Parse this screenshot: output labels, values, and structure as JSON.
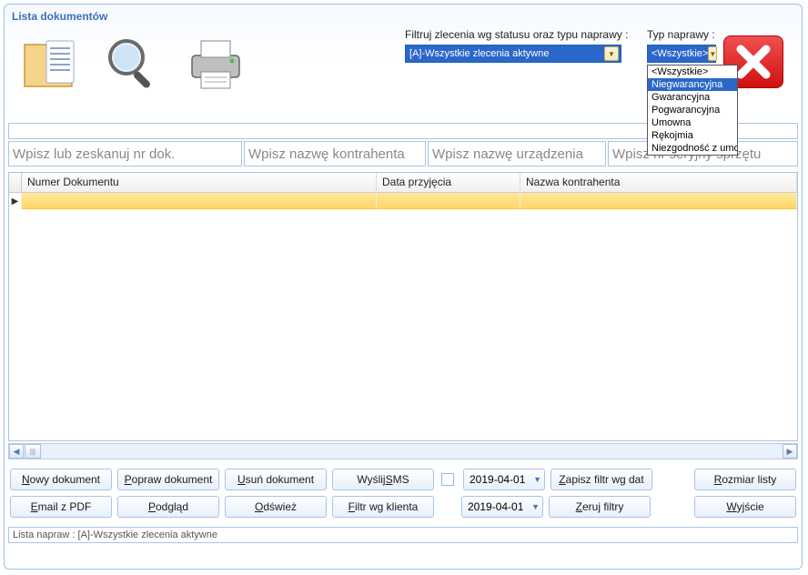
{
  "panel": {
    "title": "Lista dokumentów"
  },
  "filter": {
    "status_label": "Filtruj zlecenia wg statusu oraz typu naprawy :",
    "status_value": "[A]-Wszystkie zlecenia aktywne",
    "type_label": "Typ naprawy :",
    "type_value": "<Wszystkie>",
    "type_options": [
      "<Wszystkie>",
      "Niegwarancyjna",
      "Gwarancyjna",
      "Pogwarancyjna",
      "Umowna",
      "Rękojmia",
      "Niezgodność z umową"
    ],
    "type_selected_index": 1
  },
  "search": {
    "doc_placeholder": "Wpisz lub zeskanuj nr dok.",
    "contractor_placeholder": "Wpisz nazwę kontrahenta",
    "device_placeholder": "Wpisz nazwę urządzenia",
    "serial_placeholder": "Wpisz nr seryjny sprzętu"
  },
  "grid": {
    "columns": [
      "Numer Dokumentu",
      "Data przyjęcia",
      "Nazwa kontrahenta"
    ],
    "rows": [
      {
        "doc": "",
        "date": "",
        "contractor": ""
      }
    ]
  },
  "dates": {
    "from": "2019-04-01",
    "to": "2019-04-01"
  },
  "buttons": {
    "new_doc": "Nowy dokument",
    "edit_doc": "Popraw dokument",
    "del_doc": "Usuń dokument",
    "send_sms": "Wyślij SMS",
    "save_filter": "Zapisz filtr wg dat",
    "list_size": "Rozmiar listy",
    "email_pdf": "Email z PDF",
    "preview": "Podgląd",
    "refresh": "Odśwież",
    "filter_client": "Filtr wg klienta",
    "clear_filters": "Zeruj filtry",
    "exit": "Wyjście"
  },
  "status_bar": "Lista napraw : [A]-Wszystkie zlecenia aktywne"
}
